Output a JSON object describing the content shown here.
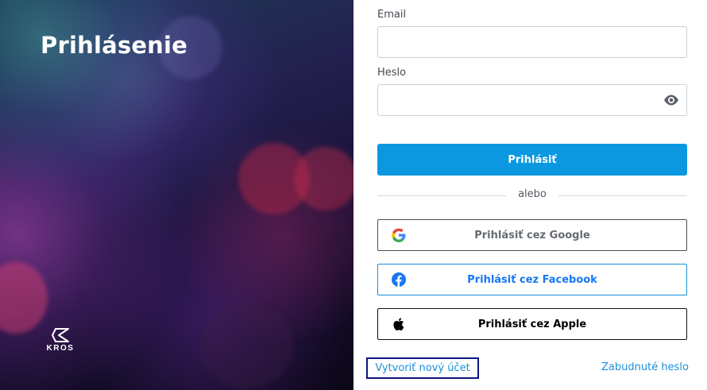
{
  "hero": {
    "title": "Prihlásenie",
    "logo_text": "KROS"
  },
  "form": {
    "email_label": "Email",
    "email_value": "",
    "password_label": "Heslo",
    "password_value": "",
    "submit_label": "Prihlásiť",
    "divider_text": "alebo",
    "google_label": "Prihlásiť cez Google",
    "facebook_label": "Prihlásiť cez Facebook",
    "apple_label": "Prihlásiť cez Apple"
  },
  "links": {
    "create_account": "Vytvoriť nový účet",
    "forgot_password": "Zabudnuté heslo"
  },
  "colors": {
    "primary": "#0b98e0",
    "facebook": "#1877f2",
    "link": "#1a8fd9",
    "focus_outline": "#0b1680"
  },
  "icons": {
    "password_toggle": "eye-icon",
    "google": "google-icon",
    "facebook": "facebook-icon",
    "apple": "apple-icon",
    "brand": "kros-logo-icon"
  }
}
